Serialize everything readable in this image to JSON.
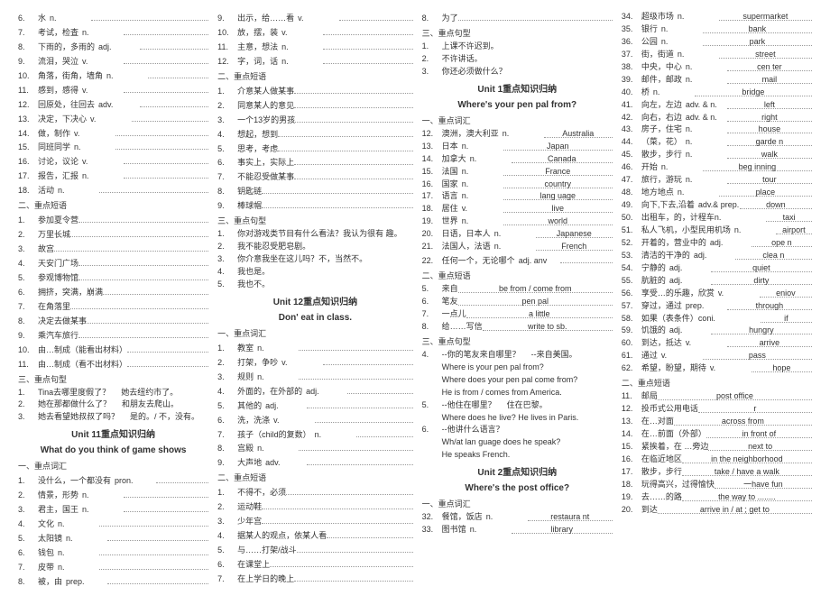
{
  "col1": {
    "vocab": [
      {
        "n": "6.",
        "cn": "水",
        "pos": "n."
      },
      {
        "n": "7.",
        "cn": "考试，检査",
        "pos": "n."
      },
      {
        "n": "8.",
        "cn": "下雨的，多雨的",
        "pos": "adj."
      },
      {
        "n": "9.",
        "cn": "流泪，哭泣",
        "pos": "v."
      },
      {
        "n": "10.",
        "cn": "角落，街角，墙角",
        "pos": "n."
      },
      {
        "n": "11.",
        "cn": "感到，感得",
        "pos": "v."
      },
      {
        "n": "12.",
        "cn": "回原处，往回去",
        "pos": "adv."
      },
      {
        "n": "13.",
        "cn": "决定，下决心",
        "pos": "v."
      },
      {
        "n": "14.",
        "cn": "做，制作",
        "pos": "v."
      },
      {
        "n": "15.",
        "cn": "同班同学",
        "pos": "n."
      },
      {
        "n": "16.",
        "cn": "讨论，议论",
        "pos": "v."
      },
      {
        "n": "17.",
        "cn": "报告，汇报",
        "pos": "n."
      },
      {
        "n": "18.",
        "cn": "活动",
        "pos": "n."
      }
    ],
    "sub1": "二、重点短语",
    "phrases": [
      {
        "n": "1.",
        "cn": "参加夏令营"
      },
      {
        "n": "2.",
        "cn": "万里长城"
      },
      {
        "n": "3.",
        "cn": "故宫"
      },
      {
        "n": "4.",
        "cn": "天安门广场"
      },
      {
        "n": "5.",
        "cn": "参观博物馆"
      },
      {
        "n": "6.",
        "cn": "拥挤，突满，崩满"
      },
      {
        "n": "7.",
        "cn": "在角落里"
      },
      {
        "n": "8.",
        "cn": "决定去做某事"
      },
      {
        "n": "9.",
        "cn": "乘汽车旅行"
      },
      {
        "n": "10.",
        "cn": "由…制成（能看出材料）"
      },
      {
        "n": "11.",
        "cn": "由…制成（看不出材料）"
      }
    ],
    "sub2": "三、重点句型",
    "sent": [
      {
        "n": "1.",
        "a": "Tina去哪里度假了？",
        "b": "她去纽约市了。"
      },
      {
        "n": "2.",
        "a": "她在那都做什么了？",
        "b": "和朋友去爬山。"
      },
      {
        "n": "3.",
        "a": "她去看望她叔叔了吗？",
        "b": "是的。/ 不，没有。"
      }
    ],
    "unit11": "Unit 11重点知识归纳",
    "unit11b": "What do you think of game shows",
    "sub3": "一、重点词汇",
    "v2": [
      {
        "n": "1.",
        "cn": "没什么，一个都没有",
        "pos": "pron."
      },
      {
        "n": "2.",
        "cn": "情景，形势",
        "pos": "n."
      },
      {
        "n": "3.",
        "cn": "君主，国王",
        "pos": "n."
      },
      {
        "n": "4.",
        "cn": "文化",
        "pos": "n."
      },
      {
        "n": "5.",
        "cn": "太阳镜",
        "pos": "n."
      },
      {
        "n": "6.",
        "cn": "钱包",
        "pos": "n."
      },
      {
        "n": "7.",
        "cn": "皮带",
        "pos": "n."
      },
      {
        "n": "8.",
        "cn": "被，由",
        "pos": "prep."
      }
    ]
  },
  "col2": {
    "vocabTop": [
      {
        "n": "9.",
        "cn": "出示，给……看",
        "pos": "v."
      },
      {
        "n": "10.",
        "cn": "放，摆，装",
        "pos": "v."
      },
      {
        "n": "11.",
        "cn": "主意，想法",
        "pos": "n."
      },
      {
        "n": "12.",
        "cn": "字，词，话",
        "pos": "n."
      }
    ],
    "sub1": "二、重点短语",
    "phrases": [
      {
        "n": "1.",
        "cn": "介意某人做某事"
      },
      {
        "n": "2.",
        "cn": "同意某人的意见"
      },
      {
        "n": "3.",
        "cn": "一个13岁的男孩"
      },
      {
        "n": "4.",
        "cn": "想起，想到"
      },
      {
        "n": "5.",
        "cn": "思考，考虑"
      },
      {
        "n": "6.",
        "cn": "事实上，实际上"
      },
      {
        "n": "7.",
        "cn": "不能忍受做某事"
      },
      {
        "n": "8.",
        "cn": "钥匙链"
      },
      {
        "n": "9.",
        "cn": "棒球帽"
      }
    ],
    "sub2": "三、重点句型",
    "sent": [
      {
        "n": "1.",
        "cn": "你对游戏类节目有什么看法？我认为很有 趣。"
      },
      {
        "n": "2.",
        "cn": "我不能忍受肥皂剧。"
      },
      {
        "n": "3.",
        "cn": "你介意我坐在这儿吗？不，当然不。"
      },
      {
        "n": "4.",
        "cn": "我也是。"
      },
      {
        "n": "5.",
        "cn": "我也不。"
      }
    ],
    "unit12": "Unit 12重点知识归纳",
    "unit12b": "Don' eat in class.",
    "sub3": "一、重点词汇",
    "v2": [
      {
        "n": "1.",
        "cn": "教室",
        "pos": "n."
      },
      {
        "n": "2.",
        "cn": "打架，争吵",
        "pos": "v."
      },
      {
        "n": "3.",
        "cn": "规则",
        "pos": "n."
      },
      {
        "n": "4.",
        "cn": "外面的，在外部的",
        "pos": "adj."
      },
      {
        "n": "5.",
        "cn": "其他的",
        "pos": "adj."
      },
      {
        "n": "6.",
        "cn": "洗，洗涤",
        "pos": "v."
      },
      {
        "n": "7.",
        "cn": "孩子（child的复数）",
        "pos": "n."
      },
      {
        "n": "8.",
        "cn": "宫殿",
        "pos": "n."
      },
      {
        "n": "9.",
        "cn": "大声地",
        "pos": "adv."
      }
    ],
    "sub4": "二、重点短语",
    "p2": [
      {
        "n": "1.",
        "cn": "不得不，必须"
      },
      {
        "n": "2.",
        "cn": "运动鞋"
      },
      {
        "n": "3.",
        "cn": "少年宫"
      },
      {
        "n": "4.",
        "cn": "据某人的观点，依某人看"
      },
      {
        "n": "5.",
        "cn": "与……打架/战斗"
      },
      {
        "n": "6.",
        "cn": "在课堂上"
      },
      {
        "n": "7.",
        "cn": "在上学日的晚上"
      }
    ]
  },
  "col3": {
    "top": [
      {
        "n": "8.",
        "cn": "为了"
      }
    ],
    "sub1": "三、重点句型",
    "sent": [
      {
        "n": "1.",
        "cn": "上课不许迟到。"
      },
      {
        "n": "2.",
        "cn": "不许讲话。"
      },
      {
        "n": "3.",
        "cn": "你还必须做什么？"
      }
    ],
    "unit1": "Unit 1重点知识归纳",
    "unit1b": "Where's your pen pal from?",
    "sub2": "一、重点词汇",
    "vocab": [
      {
        "n": "12.",
        "cn": "澳洲，澳大利亚",
        "pos": "n.",
        "ans": "Australia"
      },
      {
        "n": "13.",
        "cn": "日本",
        "pos": "n.",
        "ans": "Japan"
      },
      {
        "n": "14.",
        "cn": "加拿大",
        "pos": "n.",
        "ans": "Canada"
      },
      {
        "n": "15.",
        "cn": "法国",
        "pos": "n.",
        "ans": "France"
      },
      {
        "n": "16.",
        "cn": "国家",
        "pos": "n.",
        "ans": "country"
      },
      {
        "n": "17.",
        "cn": "语言",
        "pos": "n.",
        "ans": "lang uage"
      },
      {
        "n": "18.",
        "cn": "居住",
        "pos": "v.",
        "ans": "live"
      },
      {
        "n": "19.",
        "cn": "世界",
        "pos": "n.",
        "ans": "world"
      },
      {
        "n": "20.",
        "cn": "日语，日本人",
        "pos": "n.",
        "ans": "Japanese"
      },
      {
        "n": "21.",
        "cn": "法国人，法语",
        "pos": "n.",
        "ans": "French"
      },
      {
        "n": "22.",
        "cn": "任何一个，无论哪个",
        "pos": "adj. anv",
        "ans": ""
      }
    ],
    "sub3": "二、重点短语",
    "phrases": [
      {
        "n": "5.",
        "cn": "来自",
        "ans": "be from / come from"
      },
      {
        "n": "6.",
        "cn": "笔友",
        "ans": "pen pal"
      },
      {
        "n": "7.",
        "cn": "一点儿",
        "ans": "a little"
      },
      {
        "n": "8.",
        "cn": "给……写信",
        "ans": "write to sb."
      }
    ],
    "sub4": "三、重点句型",
    "s2": [
      {
        "n": "4.",
        "a": "--你的笔友来自哪里？",
        "b": "--来自美国。"
      },
      {
        "indent": "Where is your pen pal from?"
      },
      {
        "indent": "Where does your pen pal come from?"
      },
      {
        "indent": "He is from / comes from America."
      },
      {
        "n": "5.",
        "a": "--他住在哪里？",
        "b": "住在巴黎。"
      },
      {
        "indent": "Where does he live? He lives in Paris."
      },
      {
        "n": "6.",
        "a": "--他讲什么语言？",
        "b": ""
      },
      {
        "indent": "Wh/at lan guage does he speak?"
      },
      {
        "indent": "He speaks French."
      }
    ],
    "unit2": "Unit 2重点知识归纳",
    "unit2b": "Where's the post office?",
    "sub5": "一、重点词汇",
    "v2": [
      {
        "n": "32.",
        "cn": "餐馆，饭店",
        "pos": "n.",
        "ans": "restaura nt"
      },
      {
        "n": "33.",
        "cn": "图书馆",
        "pos": "n.",
        "ans": "library"
      }
    ]
  },
  "col4": {
    "vocab": [
      {
        "n": "34.",
        "cn": "超级市场",
        "pos": "n.",
        "ans": "supermarket"
      },
      {
        "n": "35.",
        "cn": "银行",
        "pos": "n.",
        "ans": "bank"
      },
      {
        "n": "36.",
        "cn": "公园",
        "pos": "n.",
        "ans": "park"
      },
      {
        "n": "37.",
        "cn": "街，街道",
        "pos": "n.",
        "ans": "street"
      },
      {
        "n": "38.",
        "cn": "中央，中心",
        "pos": "n.",
        "ans": "cen ter"
      },
      {
        "n": "39.",
        "cn": "邮件，邮政",
        "pos": "n.",
        "ans": "mail"
      },
      {
        "n": "40.",
        "cn": "桥",
        "pos": "n.",
        "ans": "bridge"
      },
      {
        "n": "41.",
        "cn": "向左，左边",
        "pos": "adv. & n.",
        "ans": "left"
      },
      {
        "n": "42.",
        "cn": "向右，右边",
        "pos": "adv. & n.",
        "ans": "right"
      },
      {
        "n": "43.",
        "cn": "房子，住宅",
        "pos": "n.",
        "ans": "house"
      },
      {
        "n": "44.",
        "cn": "（菜，花）",
        "pos": "n.",
        "ans": "garde n"
      },
      {
        "n": "45.",
        "cn": "散步，步行",
        "pos": "n.",
        "ans": "walk"
      },
      {
        "n": "46.",
        "cn": "开始",
        "pos": "n.",
        "ans": "beg inning"
      },
      {
        "n": "47.",
        "cn": "旅行，游玩",
        "pos": "n.",
        "ans": "tour"
      },
      {
        "n": "48.",
        "cn": "地方地点",
        "pos": "n.",
        "ans": "place"
      },
      {
        "n": "49.",
        "cn": "向下,下去,沿着",
        "pos": "adv.& prep.",
        "ans": "down"
      },
      {
        "n": "50.",
        "cn": "出租车，的，计程车n.",
        "pos": "",
        "ans": "taxi"
      },
      {
        "n": "51.",
        "cn": "私人飞机，小型民用机场",
        "pos": "n.",
        "ans": "airport"
      },
      {
        "n": "52.",
        "cn": "开着的，营业中的",
        "pos": "adj.",
        "ans": "ope n"
      },
      {
        "n": "53.",
        "cn": "清洁的干净的",
        "pos": "adj.",
        "ans": "clea n"
      },
      {
        "n": "54.",
        "cn": "宁静的",
        "pos": "adj.",
        "ans": "quiet"
      },
      {
        "n": "55.",
        "cn": "肮脏的",
        "pos": "adj.",
        "ans": "dirty"
      },
      {
        "n": "56.",
        "cn": "享受…的乐趣，欣赏",
        "pos": "v.",
        "ans": "eniov"
      },
      {
        "n": "57.",
        "cn": "穿过，通过",
        "pos": "prep.",
        "ans": "through"
      },
      {
        "n": "58.",
        "cn": "如果（表条件）coni.",
        "pos": "",
        "ans": "if"
      },
      {
        "n": "59.",
        "cn": "饥饿的",
        "pos": "adj.",
        "ans": "hungry"
      },
      {
        "n": "60.",
        "cn": "到达，抵达",
        "pos": "v.",
        "ans": "arrive"
      },
      {
        "n": "61.",
        "cn": "通过",
        "pos": "v.",
        "ans": "pass"
      },
      {
        "n": "62.",
        "cn": "希望，盼望，期待",
        "pos": "v.",
        "ans": "hope"
      }
    ],
    "sub1": "二、重点短语",
    "phrases": [
      {
        "n": "11.",
        "cn": "邮局",
        "ans": "post office"
      },
      {
        "n": "12.",
        "cn": "投币式公用电话",
        "ans": "r"
      },
      {
        "n": "13.",
        "cn": "在…对面",
        "ans": "across from"
      },
      {
        "n": "14.",
        "cn": "在…前面（外部）",
        "ans": "in front of"
      },
      {
        "n": "15.",
        "cn": "紧挨着，在 …旁边",
        "ans": "next to"
      },
      {
        "n": "16.",
        "cn": "在临近地区",
        "ans": "in the neighborhood"
      },
      {
        "n": "17.",
        "cn": "散步，步行",
        "ans": "take / have a walk"
      },
      {
        "n": "18.",
        "cn": "玩得高兴，过得愉快",
        "ans": "一have fun"
      },
      {
        "n": "19.",
        "cn": "去……的路",
        "ans": "the way to ........"
      },
      {
        "n": "20.",
        "cn": "到达",
        "ans": "arrive in / at ; get to"
      }
    ]
  }
}
